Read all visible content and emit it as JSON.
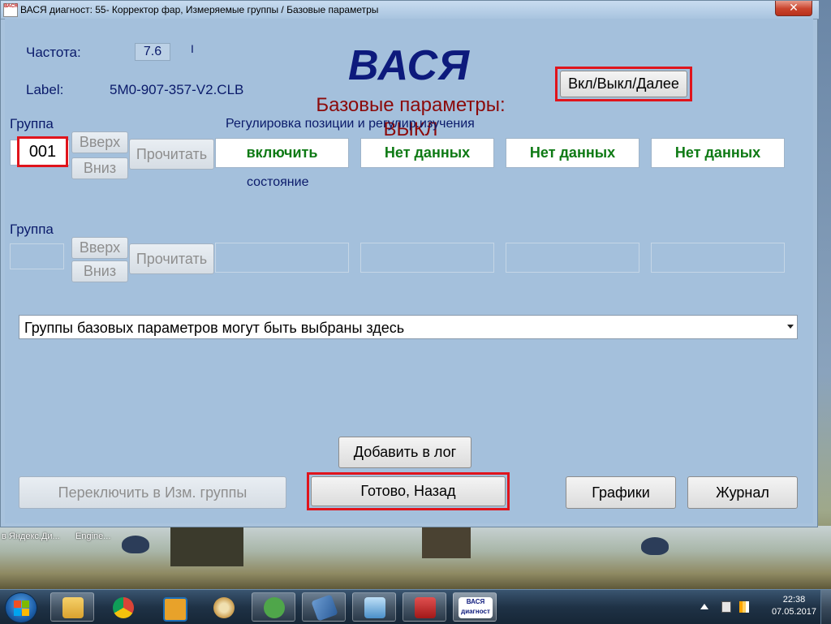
{
  "window": {
    "title": "ВАСЯ диагност: 55- Корректор фар,  Измеряемые группы / Базовые параметры",
    "close_label": "✕",
    "icon_text": "ВАСЯ"
  },
  "header": {
    "frequency_label": "Частота:",
    "frequency_value": "7.6",
    "frequency_cursor": "I",
    "label_caption": "Label:",
    "label_value": "5M0-907-357-V2.CLB",
    "brand": "ВАСЯ",
    "mode_title_line1": "Базовые параметры:",
    "mode_title_line2": "ВЫКЛ",
    "toggle_button": "Вкл/Выкл/Далее"
  },
  "group1": {
    "label": "Группа",
    "number": "001",
    "up_button": "Вверх",
    "down_button": "Вниз",
    "read_button": "Прочитать",
    "caption": "Регулировка позиции и регулир.изучения",
    "fields": [
      "включить",
      "Нет данных",
      "Нет данных",
      "Нет данных"
    ],
    "field1_sublabel": "состояние"
  },
  "group2": {
    "label": "Группа",
    "number": "",
    "up_button": "Вверх",
    "down_button": "Вниз",
    "read_button": "Прочитать",
    "fields": [
      "",
      "",
      "",
      ""
    ]
  },
  "selector": {
    "value": "Группы базовых параметров могут быть выбраны здесь"
  },
  "footer": {
    "add_log_button": "Добавить в лог",
    "switch_button": "Переключить в Изм. группы",
    "done_button": "Готово, Назад",
    "graphs_button": "Графики",
    "journal_button": "Журнал"
  },
  "desktop": {
    "text1": "в Яндекс.Ди...",
    "text2": "Engine..."
  },
  "taskbar": {
    "items": [
      "file-explorer",
      "chrome",
      "app-orange",
      "paint",
      "car-app",
      "usb-cable",
      "control-panel",
      "toolbox",
      "vasya-diagnost"
    ],
    "vasya_icon_text": "ВАСЯ диагност",
    "time": "22:38",
    "date": "07.05.2017"
  },
  "colors": {
    "window_bg": "#a4c0dc",
    "brand_blue": "#0d1a7c",
    "label_blue": "#0a1a6a",
    "mode_red": "#8b0a0a",
    "value_green": "#0e7a14",
    "highlight_red": "#e0141c"
  }
}
